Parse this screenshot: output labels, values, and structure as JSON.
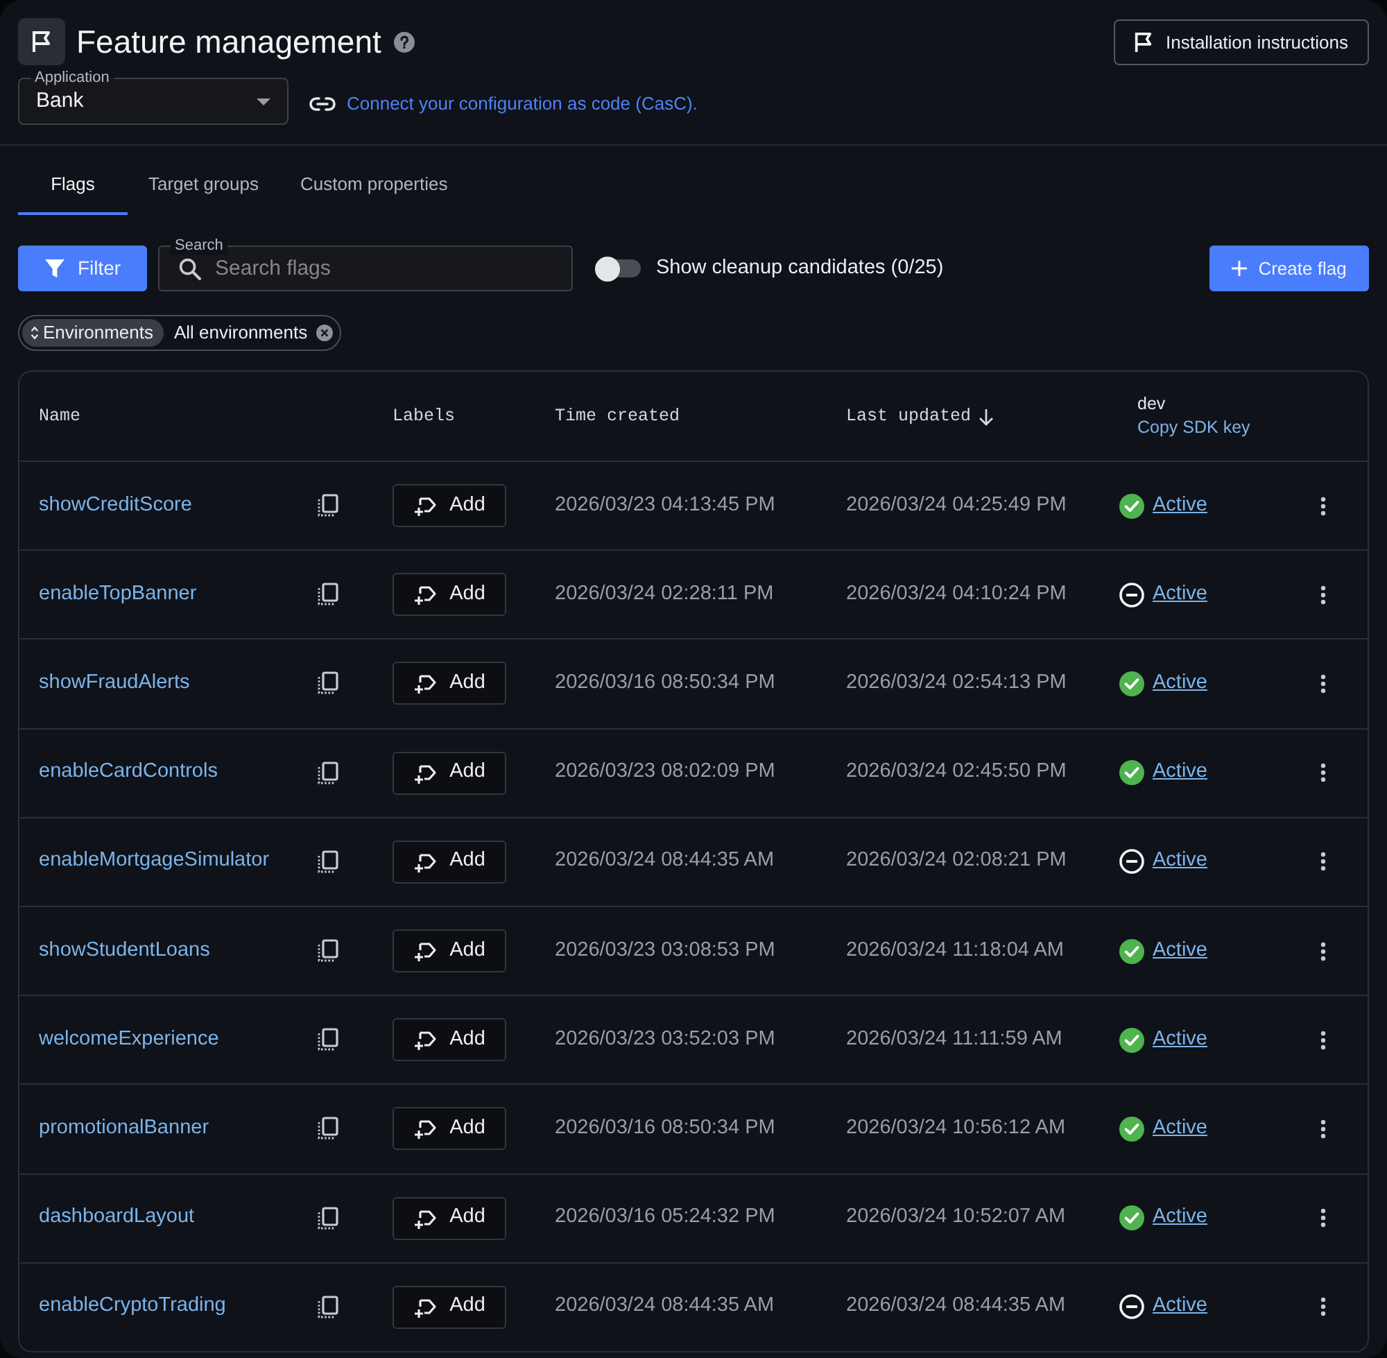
{
  "header": {
    "title": "Feature management",
    "application": {
      "label": "Application",
      "value": "Bank"
    },
    "casc_link": "Connect your configuration as code (CasC).",
    "install_button": "Installation instructions"
  },
  "tabs": [
    {
      "label": "Flags",
      "selected": true
    },
    {
      "label": "Target groups",
      "selected": false
    },
    {
      "label": "Custom properties",
      "selected": false
    }
  ],
  "toolbar": {
    "filter_button": "Filter",
    "search": {
      "label": "Search",
      "placeholder": "Search flags"
    },
    "cleanup_toggle": {
      "label": "Show cleanup candidates (0/25)",
      "on": false
    },
    "create_button": "Create flag"
  },
  "filter_chips": [
    {
      "field": "Environments",
      "value": "All environments"
    }
  ],
  "table": {
    "columns": [
      {
        "label": "Name",
        "sorted": false
      },
      {
        "label": "Labels",
        "sorted": false
      },
      {
        "label": "Time created",
        "sorted": false
      },
      {
        "label": "Last updated",
        "sorted": true
      }
    ],
    "environment_column": {
      "environment": "dev",
      "action": "Copy SDK key"
    },
    "rows": [
      {
        "name": "showCreditScore",
        "add_label": "Add",
        "time_created": "2026/03/23 04:13:45 PM",
        "last_updated": "2026/03/24 04:25:49 PM",
        "enabled": true,
        "status": "Active"
      },
      {
        "name": "enableTopBanner",
        "add_label": "Add",
        "time_created": "2026/03/24 02:28:11 PM",
        "last_updated": "2026/03/24 04:10:24 PM",
        "enabled": false,
        "status": "Active"
      },
      {
        "name": "showFraudAlerts",
        "add_label": "Add",
        "time_created": "2026/03/16 08:50:34 PM",
        "last_updated": "2026/03/24 02:54:13 PM",
        "enabled": true,
        "status": "Active"
      },
      {
        "name": "enableCardControls",
        "add_label": "Add",
        "time_created": "2026/03/23 08:02:09 PM",
        "last_updated": "2026/03/24 02:45:50 PM",
        "enabled": true,
        "status": "Active"
      },
      {
        "name": "enableMortgageSimulator",
        "add_label": "Add",
        "time_created": "2026/03/24 08:44:35 AM",
        "last_updated": "2026/03/24 02:08:21 PM",
        "enabled": false,
        "status": "Active"
      },
      {
        "name": "showStudentLoans",
        "add_label": "Add",
        "time_created": "2026/03/23 03:08:53 PM",
        "last_updated": "2026/03/24 11:18:04 AM",
        "enabled": true,
        "status": "Active"
      },
      {
        "name": "welcomeExperience",
        "add_label": "Add",
        "time_created": "2026/03/23 03:52:03 PM",
        "last_updated": "2026/03/24 11:11:59 AM",
        "enabled": true,
        "status": "Active"
      },
      {
        "name": "promotionalBanner",
        "add_label": "Add",
        "time_created": "2026/03/16 08:50:34 PM",
        "last_updated": "2026/03/24 10:56:12 AM",
        "enabled": true,
        "status": "Active"
      },
      {
        "name": "dashboardLayout",
        "add_label": "Add",
        "time_created": "2026/03/16 05:24:32 PM",
        "last_updated": "2026/03/24 10:52:07 AM",
        "enabled": true,
        "status": "Active"
      },
      {
        "name": "enableCryptoTrading",
        "add_label": "Add",
        "time_created": "2026/03/24 08:44:35 AM",
        "last_updated": "2026/03/24 08:44:35 AM",
        "enabled": false,
        "status": "Active"
      }
    ]
  }
}
